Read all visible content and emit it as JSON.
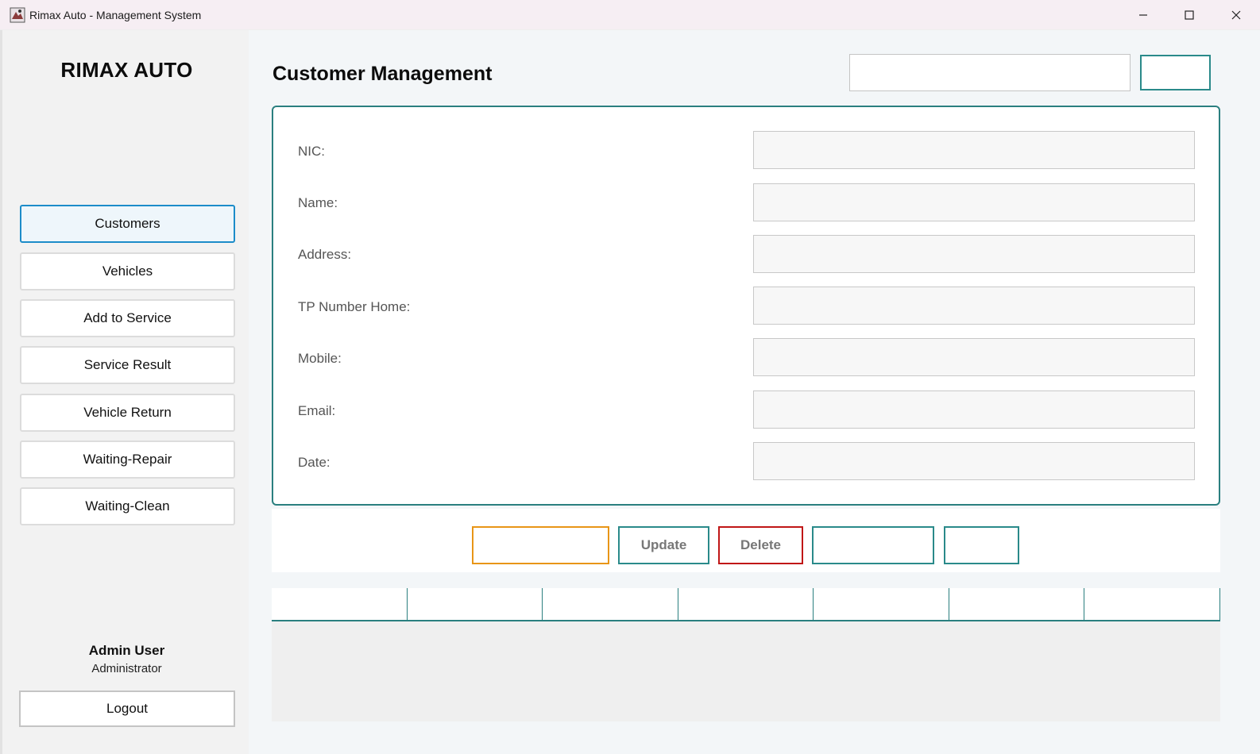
{
  "window": {
    "title": "Rimax Auto - Management System",
    "controls": {
      "minimize": "—",
      "maximize": "☐",
      "close": "✕"
    }
  },
  "sidebar": {
    "brand": "RIMAX AUTO",
    "items": [
      {
        "label": "Customers",
        "active": true
      },
      {
        "label": "Vehicles",
        "active": false
      },
      {
        "label": "Add to Service",
        "active": false
      },
      {
        "label": "Service Result",
        "active": false
      },
      {
        "label": "Vehicle Return",
        "active": false
      },
      {
        "label": "Waiting-Repair",
        "active": false
      },
      {
        "label": "Waiting-Clean",
        "active": false
      }
    ],
    "user": {
      "name": "Admin User",
      "role": "Administrator"
    },
    "logout_label": "Logout"
  },
  "main": {
    "title": "Customer Management",
    "search": {
      "value": "",
      "placeholder": "",
      "button_label": ""
    },
    "form": {
      "fields": [
        {
          "label": "NIC:",
          "value": ""
        },
        {
          "label": "Name:",
          "value": ""
        },
        {
          "label": "Address:",
          "value": ""
        },
        {
          "label": "TP Number Home:",
          "value": ""
        },
        {
          "label": "Mobile:",
          "value": ""
        },
        {
          "label": "Email:",
          "value": ""
        },
        {
          "label": "Date:",
          "value": ""
        }
      ]
    },
    "actions": {
      "add_label": "",
      "update_label": "Update",
      "delete_label": "Delete",
      "vehicle_label": "",
      "clear_label": ""
    },
    "table": {
      "columns": [
        "",
        "",
        "",
        "",
        "",
        "",
        ""
      ],
      "rows": []
    }
  },
  "colors": {
    "accent_teal": "#2a7f7f",
    "active_blue": "#1c8cc9",
    "add_orange": "#e89517",
    "delete_red": "#c01616",
    "titlebar_bg": "#f6eef3",
    "sidebar_bg": "#f2f2f2",
    "main_bg": "#f3f6f8"
  }
}
